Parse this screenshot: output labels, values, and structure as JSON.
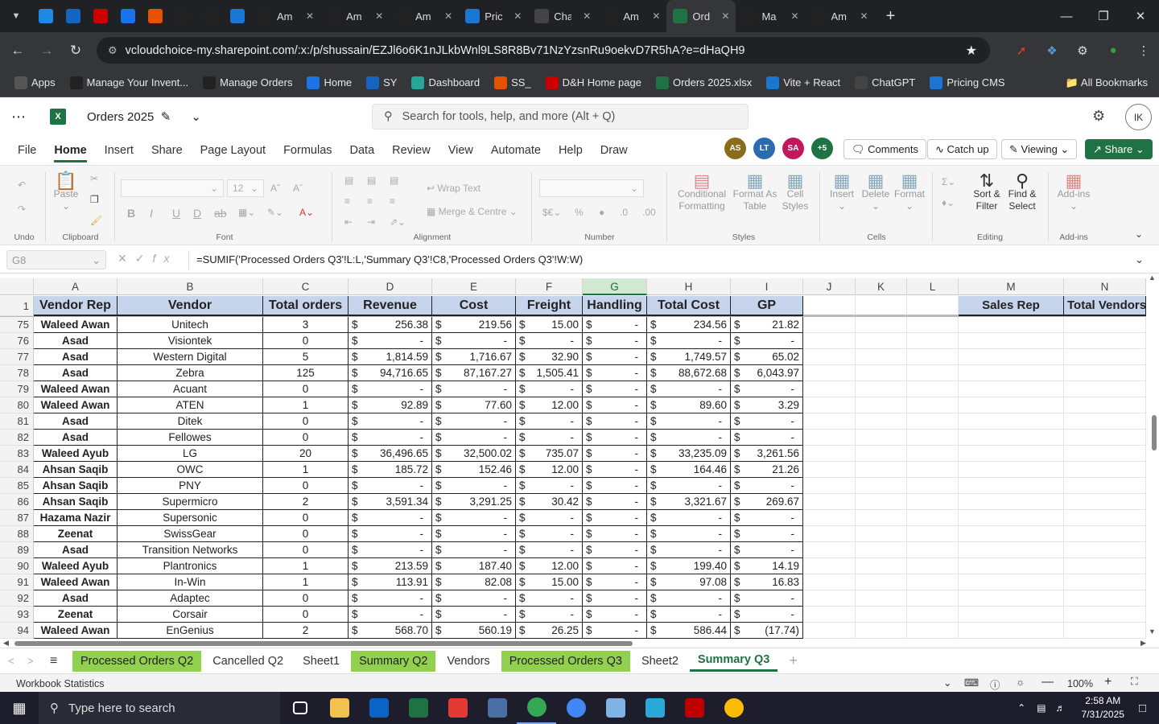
{
  "browser": {
    "tabs": [
      {
        "label": "",
        "icon": "edge-icon",
        "color": "#1e88e5"
      },
      {
        "label": "",
        "icon": "ecwid-icon",
        "color": "#1565c0"
      },
      {
        "label": "",
        "icon": "dh-icon",
        "color": "#c00"
      },
      {
        "label": "",
        "icon": "google-docs-icon",
        "color": "#1a73e8"
      },
      {
        "label": "",
        "icon": "stack-icon",
        "color": "#e65100"
      },
      {
        "label": "",
        "icon": "amazon-icon",
        "color": "#222"
      },
      {
        "label": "",
        "icon": "amazon-icon",
        "color": "#222"
      },
      {
        "label": "",
        "icon": "dollar-icon",
        "color": "#1976d2"
      },
      {
        "label": "Am",
        "icon": "amazon-icon",
        "color": "#222"
      },
      {
        "label": "Am",
        "icon": "amazon-icon",
        "color": "#222"
      },
      {
        "label": "Am",
        "icon": "amazon-icon",
        "color": "#222"
      },
      {
        "label": "Pric",
        "icon": "dollar-icon",
        "color": "#1976d2"
      },
      {
        "label": "Cha",
        "icon": "chatgpt-icon",
        "color": "#444"
      },
      {
        "label": "Am",
        "icon": "amazon-icon",
        "color": "#222"
      },
      {
        "label": "Ord",
        "icon": "excel-icon",
        "color": "#1f7244",
        "active": true
      },
      {
        "label": "Ma",
        "icon": "amazon-icon",
        "color": "#222"
      },
      {
        "label": "Am",
        "icon": "amazon-icon",
        "color": "#222"
      }
    ],
    "url": "vcloudchoice-my.sharepoint.com/:x:/p/shussain/EZJl6o6K1nJLkbWnl9LS8R8Bv71NzYzsnRu9oekvD7R5hA?e=dHaQH9",
    "bookmarks": [
      {
        "label": "Apps",
        "icon": "apps-icon",
        "color": "#555"
      },
      {
        "label": "Manage Your Invent...",
        "icon": "amazon-icon",
        "color": "#222"
      },
      {
        "label": "Manage Orders",
        "icon": "amazon-icon",
        "color": "#222"
      },
      {
        "label": "Home",
        "icon": "google-docs-icon",
        "color": "#1a73e8"
      },
      {
        "label": "SY",
        "icon": "ecwid-icon",
        "color": "#1565c0"
      },
      {
        "label": "Dashboard",
        "icon": "diamond-icon",
        "color": "#26a69a"
      },
      {
        "label": "SS_",
        "icon": "stack-icon",
        "color": "#e65100"
      },
      {
        "label": "D&H Home page",
        "icon": "dh-icon",
        "color": "#c00"
      },
      {
        "label": "Orders 2025.xlsx",
        "icon": "excel-icon",
        "color": "#1f7244"
      },
      {
        "label": "Vite + React",
        "icon": "dollar-icon",
        "color": "#1976d2"
      },
      {
        "label": "ChatGPT",
        "icon": "chatgpt-icon",
        "color": "#444"
      },
      {
        "label": "Pricing CMS",
        "icon": "dollar-icon",
        "color": "#1976d2"
      }
    ],
    "all_bookmarks": "All Bookmarks"
  },
  "excel": {
    "title": "Orders 2025",
    "search_placeholder": "Search for tools, help, and more (Alt + Q)",
    "user_initials": "IK",
    "menus": [
      "File",
      "Home",
      "Insert",
      "Share",
      "Page Layout",
      "Formulas",
      "Data",
      "Review",
      "View",
      "Automate",
      "Help",
      "Draw"
    ],
    "active_menu": "Home",
    "collaborators": [
      {
        "initials": "AS",
        "color": "#8a6d1a"
      },
      {
        "initials": "LT",
        "color": "#2b6cb0"
      },
      {
        "initials": "SA",
        "color": "#c2185b"
      },
      {
        "initials": "+5",
        "color": "#1f7244"
      }
    ],
    "comments": "Comments",
    "catch_up": "Catch up",
    "viewing": "Viewing",
    "share": "Share",
    "ribbon": {
      "undo": "Undo",
      "clipboard": "Clipboard",
      "paste": "Paste",
      "font": "Font",
      "font_size": "12",
      "alignment": "Alignment",
      "wrap_text": "Wrap Text",
      "merge_centre": "Merge & Centre",
      "number": "Number",
      "styles": "Styles",
      "conditional_formatting": "Conditional Formatting",
      "format_as_table": "Format As Table",
      "cell_styles": "Cell Styles",
      "cells": "Cells",
      "insert": "Insert",
      "delete": "Delete",
      "format": "Format",
      "editing": "Editing",
      "sort_filter": "Sort & Filter",
      "find_select": "Find & Select",
      "addins_group": "Add-ins",
      "addins": "Add-ins"
    },
    "name_box": "G8",
    "formula": "=SUMIF('Processed Orders Q3'!L:L,'Summary Q3'!C8,'Processed Orders Q3'!W:W)",
    "columns": [
      "A",
      "B",
      "C",
      "D",
      "E",
      "F",
      "G",
      "H",
      "I",
      "J",
      "K",
      "L",
      "M",
      "N"
    ],
    "selected_column": "G",
    "headers": [
      "Vendor Rep",
      "Vendor",
      "Total orders",
      "Revenue",
      "Cost",
      "Freight",
      "Handling",
      "Total Cost",
      "GP"
    ],
    "right_headers": [
      "Sales Rep",
      "Total Vendors"
    ],
    "header_row_number": "1",
    "rows": [
      {
        "n": "75",
        "rep": "Waleed Awan",
        "vendor": "Unitech",
        "orders": "3",
        "rev": "256.38",
        "cost": "219.56",
        "freight": "15.00",
        "handling": "-",
        "tcost": "234.56",
        "gp": "21.82"
      },
      {
        "n": "76",
        "rep": "Asad",
        "vendor": "Visiontek",
        "orders": "0",
        "rev": "-",
        "cost": "-",
        "freight": "-",
        "handling": "-",
        "tcost": "-",
        "gp": "-"
      },
      {
        "n": "77",
        "rep": "Asad",
        "vendor": "Western Digital",
        "orders": "5",
        "rev": "1,814.59",
        "cost": "1,716.67",
        "freight": "32.90",
        "handling": "-",
        "tcost": "1,749.57",
        "gp": "65.02"
      },
      {
        "n": "78",
        "rep": "Asad",
        "vendor": "Zebra",
        "orders": "125",
        "rev": "94,716.65",
        "cost": "87,167.27",
        "freight": "1,505.41",
        "handling": "-",
        "tcost": "88,672.68",
        "gp": "6,043.97"
      },
      {
        "n": "79",
        "rep": "Waleed Awan",
        "vendor": "Acuant",
        "orders": "0",
        "rev": "-",
        "cost": "-",
        "freight": "-",
        "handling": "-",
        "tcost": "-",
        "gp": "-"
      },
      {
        "n": "80",
        "rep": "Waleed Awan",
        "vendor": "ATEN",
        "orders": "1",
        "rev": "92.89",
        "cost": "77.60",
        "freight": "12.00",
        "handling": "-",
        "tcost": "89.60",
        "gp": "3.29"
      },
      {
        "n": "81",
        "rep": "Asad",
        "vendor": "Ditek",
        "orders": "0",
        "rev": "-",
        "cost": "-",
        "freight": "-",
        "handling": "-",
        "tcost": "-",
        "gp": "-"
      },
      {
        "n": "82",
        "rep": "Asad",
        "vendor": "Fellowes",
        "orders": "0",
        "rev": "-",
        "cost": "-",
        "freight": "-",
        "handling": "-",
        "tcost": "-",
        "gp": "-"
      },
      {
        "n": "83",
        "rep": "Waleed Ayub",
        "vendor": "LG",
        "orders": "20",
        "rev": "36,496.65",
        "cost": "32,500.02",
        "freight": "735.07",
        "handling": "-",
        "tcost": "33,235.09",
        "gp": "3,261.56"
      },
      {
        "n": "84",
        "rep": "Ahsan Saqib",
        "vendor": "OWC",
        "orders": "1",
        "rev": "185.72",
        "cost": "152.46",
        "freight": "12.00",
        "handling": "-",
        "tcost": "164.46",
        "gp": "21.26"
      },
      {
        "n": "85",
        "rep": "Ahsan Saqib",
        "vendor": "PNY",
        "orders": "0",
        "rev": "-",
        "cost": "-",
        "freight": "-",
        "handling": "-",
        "tcost": "-",
        "gp": "-"
      },
      {
        "n": "86",
        "rep": "Ahsan Saqib",
        "vendor": "Supermicro",
        "orders": "2",
        "rev": "3,591.34",
        "cost": "3,291.25",
        "freight": "30.42",
        "handling": "-",
        "tcost": "3,321.67",
        "gp": "269.67"
      },
      {
        "n": "87",
        "rep": "Hazama Nazir",
        "vendor": "Supersonic",
        "orders": "0",
        "rev": "-",
        "cost": "-",
        "freight": "-",
        "handling": "-",
        "tcost": "-",
        "gp": "-"
      },
      {
        "n": "88",
        "rep": "Zeenat",
        "vendor": "SwissGear",
        "orders": "0",
        "rev": "-",
        "cost": "-",
        "freight": "-",
        "handling": "-",
        "tcost": "-",
        "gp": "-"
      },
      {
        "n": "89",
        "rep": "Asad",
        "vendor": "Transition Networks",
        "orders": "0",
        "rev": "-",
        "cost": "-",
        "freight": "-",
        "handling": "-",
        "tcost": "-",
        "gp": "-"
      },
      {
        "n": "90",
        "rep": "Waleed Ayub",
        "vendor": "Plantronics",
        "orders": "1",
        "rev": "213.59",
        "cost": "187.40",
        "freight": "12.00",
        "handling": "-",
        "tcost": "199.40",
        "gp": "14.19"
      },
      {
        "n": "91",
        "rep": "Waleed Awan",
        "vendor": "In-Win",
        "orders": "1",
        "rev": "113.91",
        "cost": "82.08",
        "freight": "15.00",
        "handling": "-",
        "tcost": "97.08",
        "gp": "16.83"
      },
      {
        "n": "92",
        "rep": "Asad",
        "vendor": "Adaptec",
        "orders": "0",
        "rev": "-",
        "cost": "-",
        "freight": "-",
        "handling": "-",
        "tcost": "-",
        "gp": "-"
      },
      {
        "n": "93",
        "rep": "Zeenat",
        "vendor": "Corsair",
        "orders": "0",
        "rev": "-",
        "cost": "-",
        "freight": "-",
        "handling": "-",
        "tcost": "-",
        "gp": "-"
      },
      {
        "n": "94",
        "rep": "Waleed Awan",
        "vendor": "EnGenius",
        "orders": "2",
        "rev": "568.70",
        "cost": "560.19",
        "freight": "26.25",
        "handling": "-",
        "tcost": "586.44",
        "gp": "(17.74)"
      }
    ],
    "currency_symbol": "$",
    "sheets": [
      {
        "label": "Processed Orders Q2",
        "green": true
      },
      {
        "label": "Cancelled Q2",
        "green": false
      },
      {
        "label": "Sheet1",
        "green": false
      },
      {
        "label": "Summary Q2",
        "green": true
      },
      {
        "label": "Vendors",
        "green": false
      },
      {
        "label": "Processed Orders Q3",
        "green": true
      },
      {
        "label": "Sheet2",
        "green": false
      },
      {
        "label": "Summary Q3",
        "green": false,
        "active": true
      }
    ],
    "status_left": "Workbook Statistics",
    "zoom": "100%"
  },
  "taskbar": {
    "search_placeholder": "Type here to search",
    "time": "2:58 AM",
    "date": "7/31/2025",
    "apps": [
      {
        "icon": "task-view-icon",
        "color": "#ffffff"
      },
      {
        "icon": "file-explorer-icon",
        "color": "#f2c14e"
      },
      {
        "icon": "outlook-icon",
        "color": "#0a64c8"
      },
      {
        "icon": "excel-icon",
        "color": "#1f7244"
      },
      {
        "icon": "zoho-icon",
        "color": "#e53935"
      },
      {
        "icon": "calculator-icon",
        "color": "#4a6fa5"
      },
      {
        "icon": "chrome-icon",
        "color": "#34a853"
      },
      {
        "icon": "chrome-icon",
        "color": "#4285f4"
      },
      {
        "icon": "paper-icon",
        "color": "#7fb3e6"
      },
      {
        "icon": "vpn-icon",
        "color": "#2aa8d8"
      },
      {
        "icon": "filezilla-icon",
        "color": "#bf0000"
      },
      {
        "icon": "chrome-icon",
        "color": "#fbbc05"
      }
    ]
  }
}
